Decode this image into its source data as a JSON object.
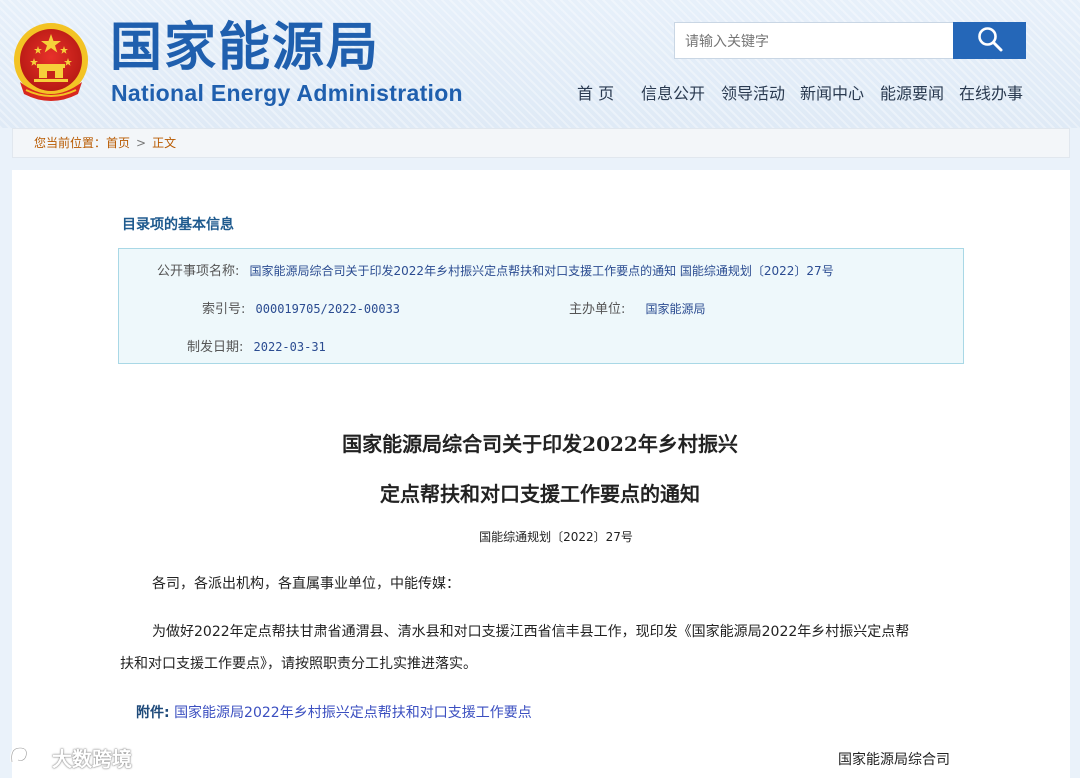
{
  "header": {
    "brand_cn": "国家能源局",
    "brand_en": "National Energy Administration",
    "search_placeholder": "请输入关键字",
    "nav": [
      "首 页",
      "信息公开",
      "领导活动",
      "新闻中心",
      "能源要闻",
      "在线办事"
    ]
  },
  "breadcrumb": {
    "prefix": "您当前位置：",
    "home": "首页",
    "separator": ">",
    "current": "正文"
  },
  "info": {
    "section_title": "目录项的基本信息",
    "name_label": "公开事项名称:",
    "name_value": "国家能源局综合司关于印发2022年乡村振兴定点帮扶和对口支援工作要点的通知 国能综通规划〔2022〕27号",
    "index_label": "索引号:",
    "index_value": "000019705/2022-00033",
    "org_label": "主办单位:",
    "org_value": "国家能源局",
    "date_label": "制发日期:",
    "date_value": "2022-03-31"
  },
  "document": {
    "title_line1": "国家能源局综合司关于印发2022年乡村振兴",
    "title_line2": "定点帮扶和对口支援工作要点的通知",
    "doc_number": "国能综通规划〔2022〕27号",
    "salutation": "各司，各派出机构，各直属事业单位，中能传媒：",
    "body_line1": "为做好2022年定点帮扶甘肃省通渭县、清水县和对口支援江西省信丰县工作，现印发《国家能源局2022年乡村振兴定点帮",
    "body_line2": "扶和对口支援工作要点》，请按照职责分工扎实推进落实。",
    "attachment_label": "附件:",
    "attachment_link": "国家能源局2022年乡村振兴定点帮扶和对口支援工作要点",
    "signer": "国家能源局综合司"
  },
  "watermark": {
    "text": "大数跨境"
  },
  "colors": {
    "brand_blue": "#1f5fae",
    "search_button": "#2567b8",
    "breadcrumb_text": "#b85a00",
    "info_background": "#eef8fb",
    "link_blue": "#3b4fc0"
  }
}
